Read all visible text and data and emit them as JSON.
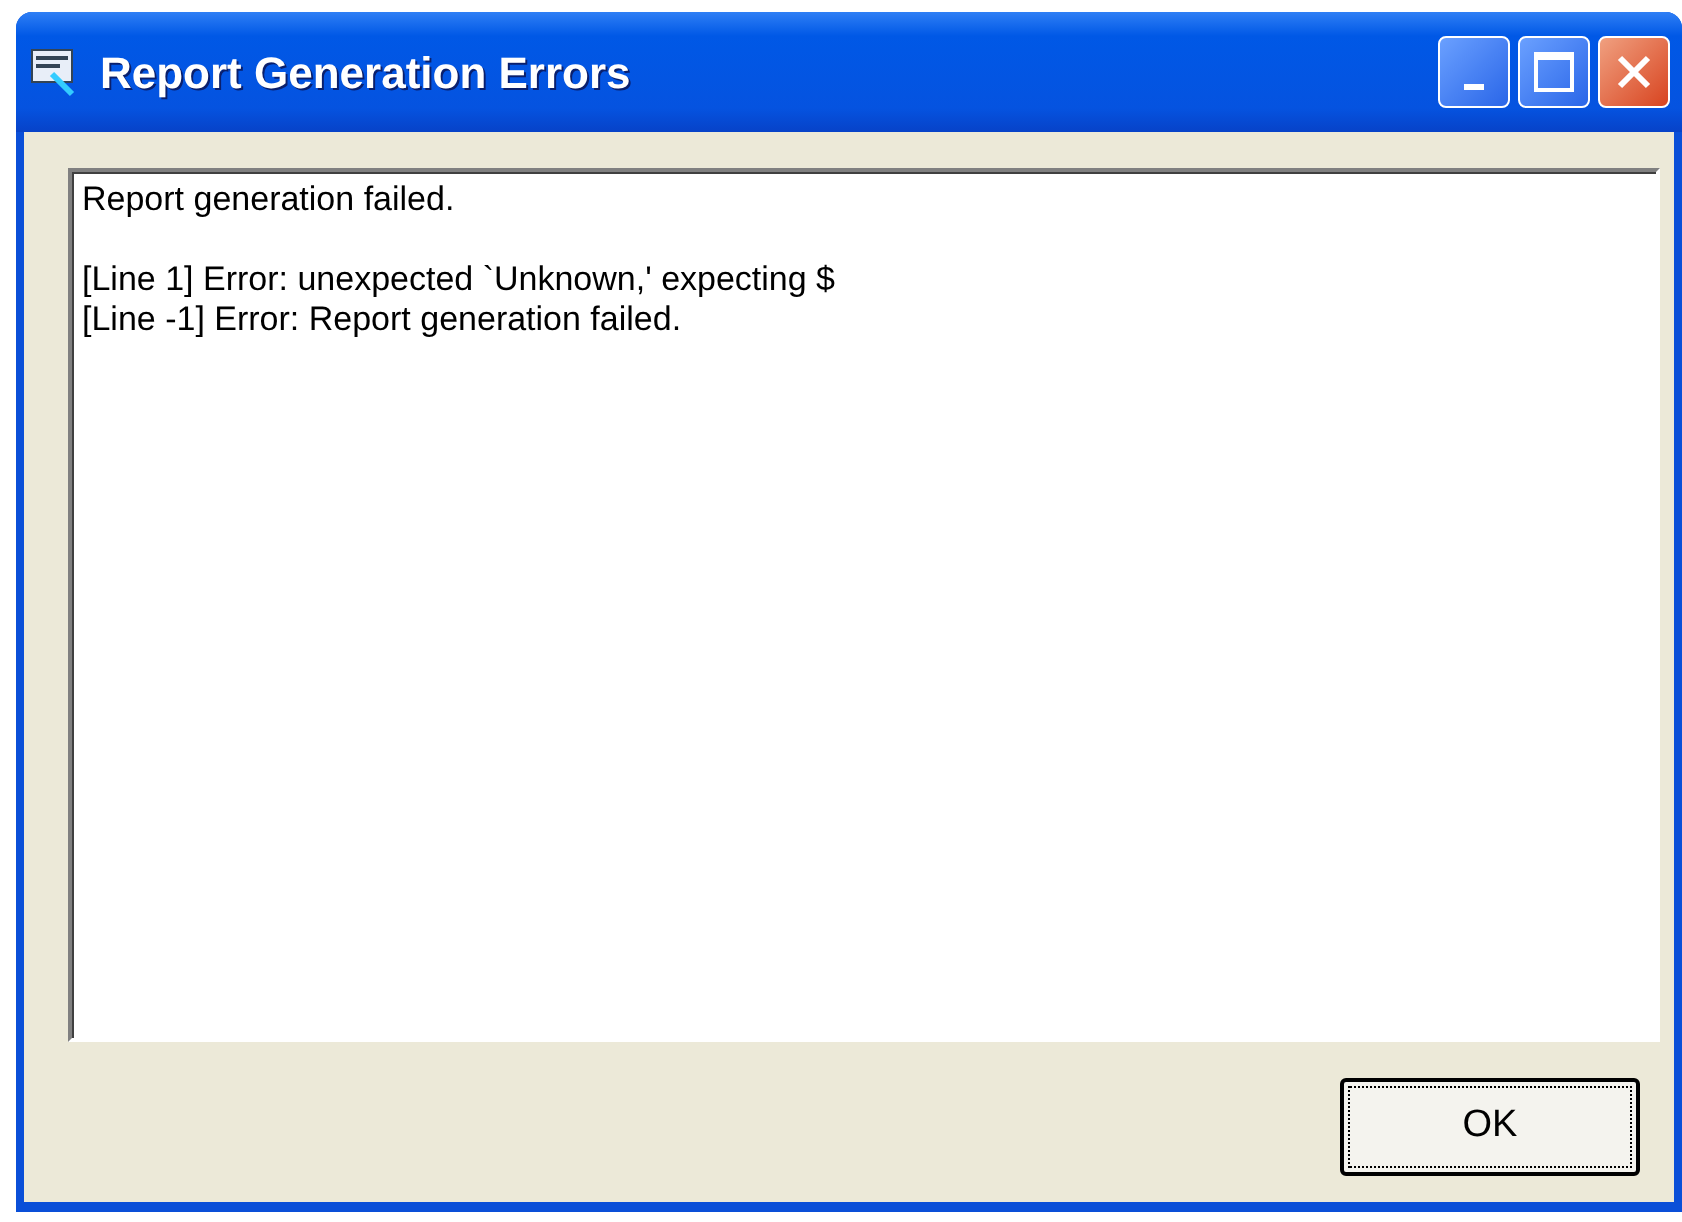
{
  "window": {
    "title": "Report Generation Errors"
  },
  "text_blocks": [
    [
      "Report generation failed."
    ],
    [
      "[Line 1] Error: unexpected `Unknown,' expecting $",
      "[Line -1] Error: Report generation failed."
    ]
  ],
  "buttons": [
    {
      "label": "OK",
      "focused": true
    }
  ]
}
